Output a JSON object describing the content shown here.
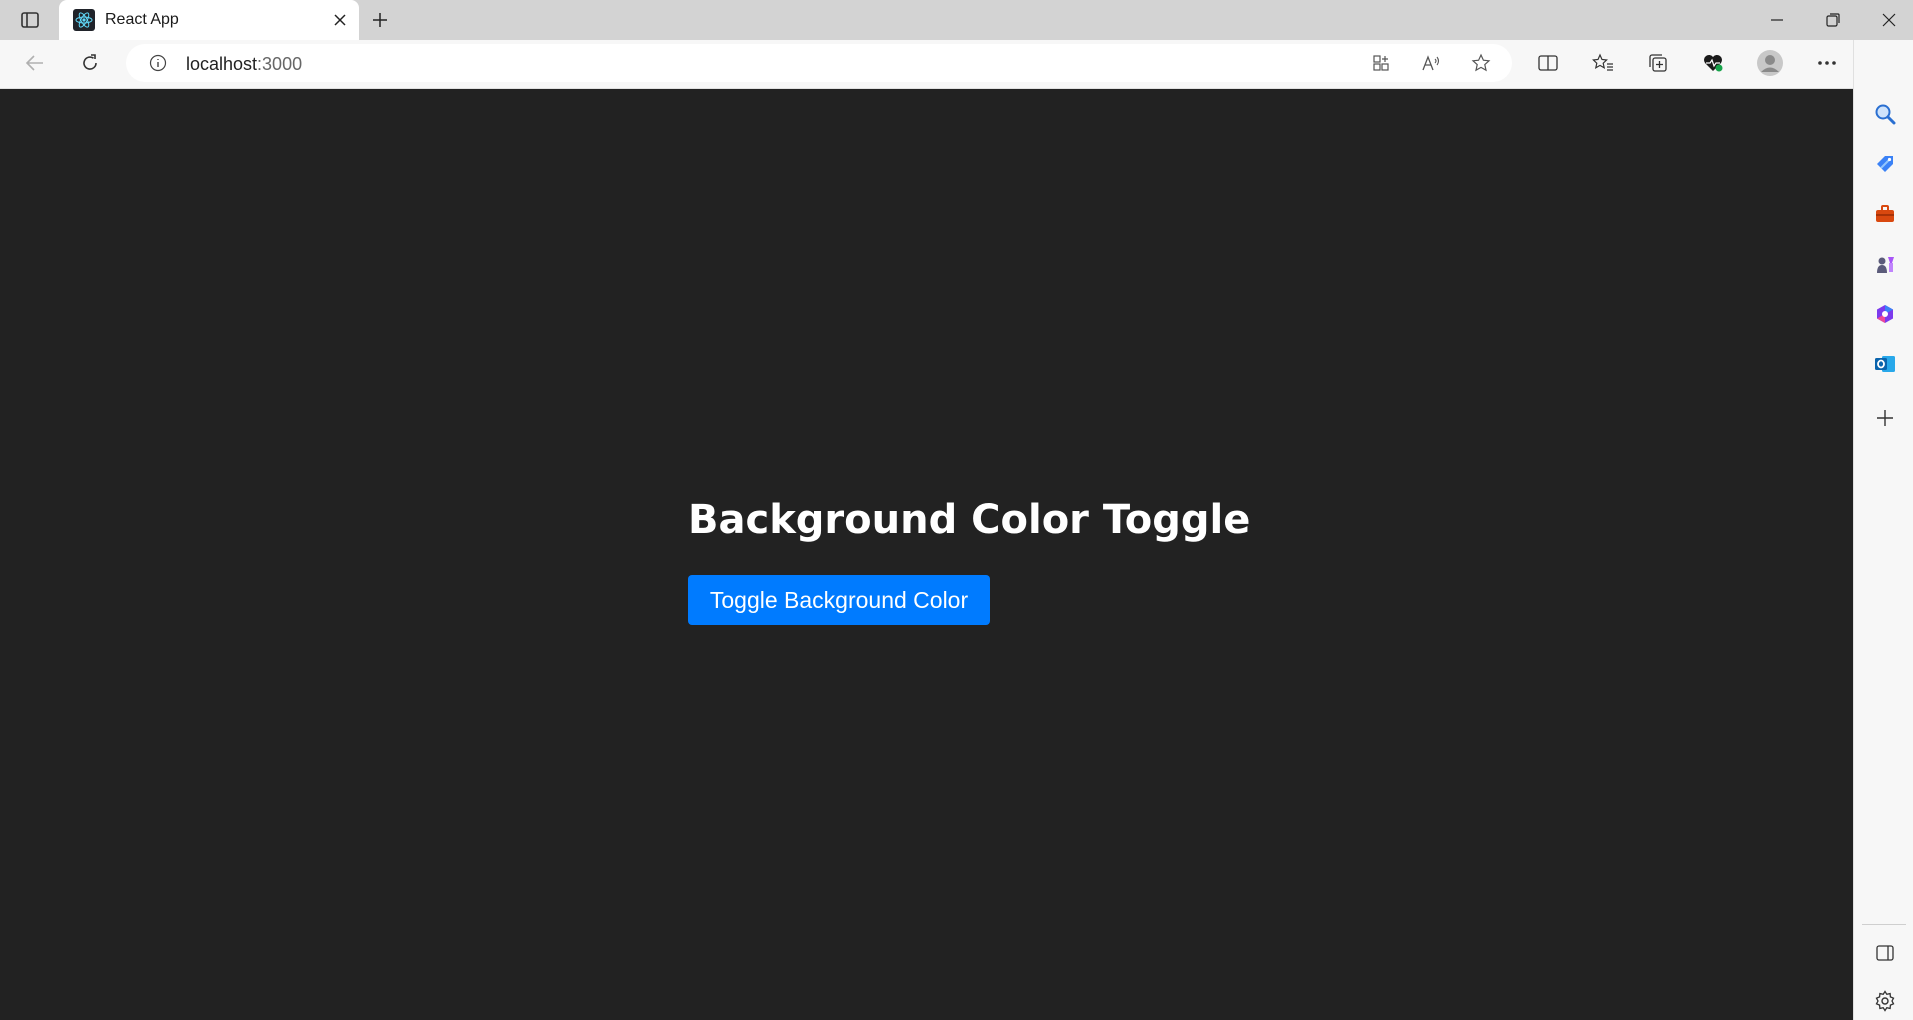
{
  "browser": {
    "tab": {
      "title": "React App",
      "favicon": "react-icon"
    },
    "address": {
      "host": "localhost",
      "port": ":3000"
    },
    "toolbar_icons": [
      "back-icon",
      "refresh-icon",
      "info-icon",
      "app-available-icon",
      "read-aloud-icon",
      "favorite-star-icon",
      "split-screen-icon",
      "favorites-icon",
      "collections-icon",
      "browser-essentials-icon",
      "profile-avatar",
      "more-menu-icon",
      "copilot-icon"
    ],
    "sidebar_icons": [
      "search-icon",
      "shopping-icon",
      "tools-icon",
      "games-icon",
      "office-icon",
      "outlook-icon",
      "add-icon",
      "hide-sidebar-icon",
      "settings-icon"
    ]
  },
  "page": {
    "heading": "Background Color Toggle",
    "button_label": "Toggle Background Color",
    "background_color": "#222222",
    "button_color": "#007bff"
  }
}
